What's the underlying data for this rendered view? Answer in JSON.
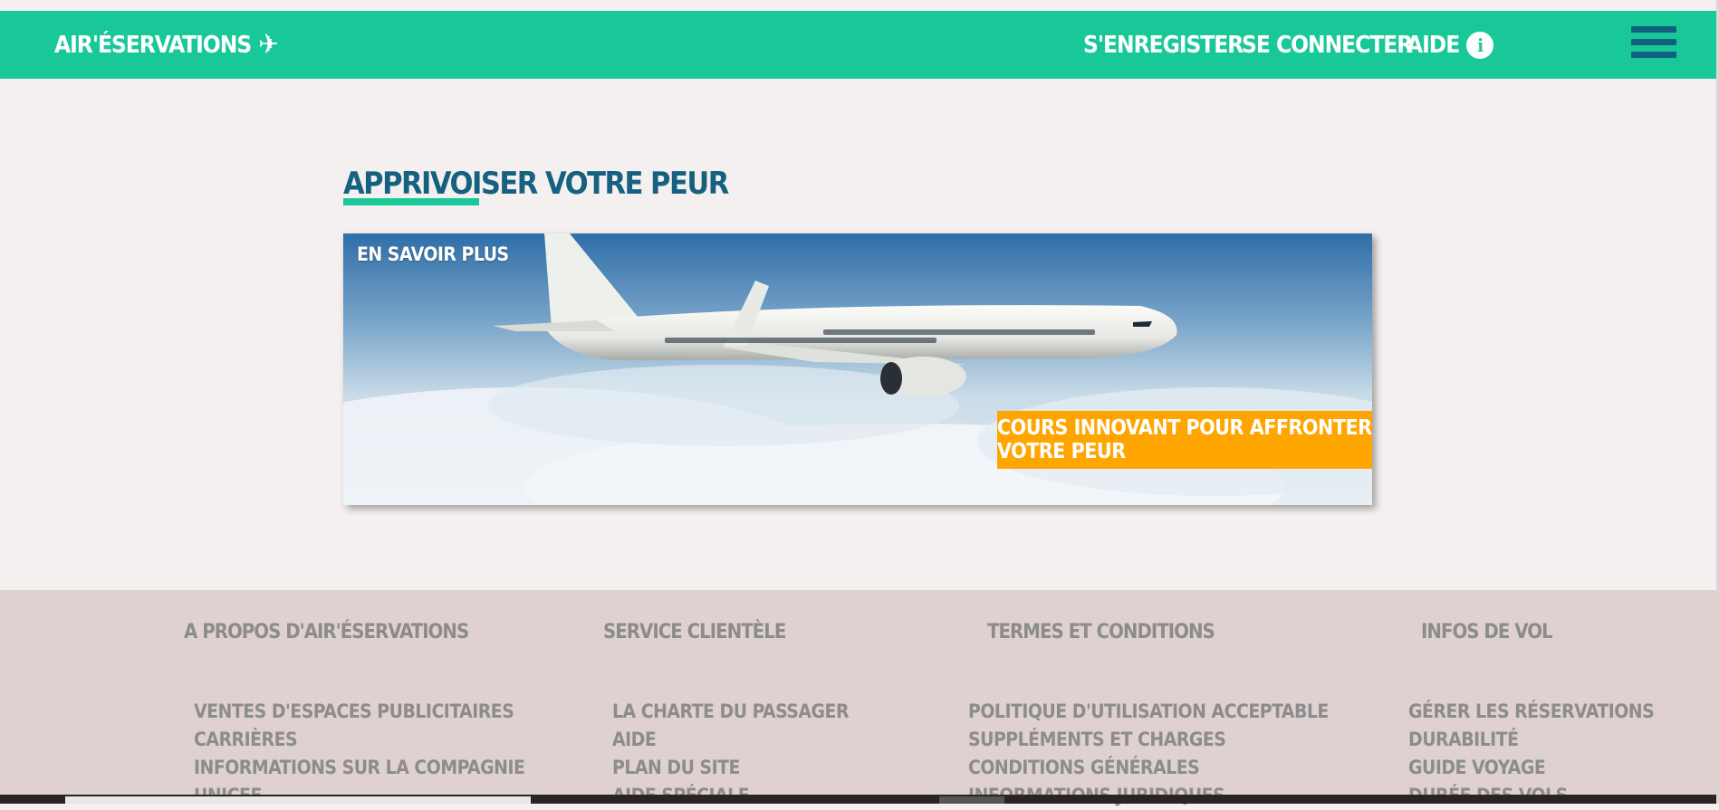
{
  "header": {
    "brand": "AIR'ÉSERVATIONS",
    "nav": {
      "register": "S'ENREGISTER",
      "login": "SE CONNECTER",
      "help": "AIDE"
    }
  },
  "main": {
    "section_title": "APPRIVOISER VOTRE PEUR",
    "hero": {
      "more_link": "EN SAVOIR PLUS",
      "cta": "COURS INNOVANT POUR AFFRONTER VOTRE PEUR"
    }
  },
  "footer": {
    "columns": [
      {
        "heading": "A PROPOS D'AIR'ÉSERVATIONS",
        "links": [
          "VENTES D'ESPACES PUBLICITAIRES",
          "CARRIÈRES",
          "INFORMATIONS SUR LA COMPAGNIE",
          "UNICEF"
        ]
      },
      {
        "heading": "SERVICE CLIENTÈLE",
        "links": [
          "LA CHARTE DU PASSAGER",
          "AIDE",
          "PLAN DU SITE",
          "AIDE SPÉCIALE"
        ]
      },
      {
        "heading": "TERMES ET CONDITIONS",
        "links": [
          "POLITIQUE D'UTILISATION ACCEPTABLE",
          "SUPPLÉMENTS ET CHARGES",
          "CONDITIONS GÉNÉRALES",
          "INFORMATIONS JURIDIQUES"
        ]
      },
      {
        "heading": "INFOS DE VOL",
        "links": [
          "GÉRER LES RÉSERVATIONS",
          "DURABILITÉ",
          "GUIDE VOYAGE",
          "DURÉE DES VOLS"
        ]
      }
    ]
  },
  "colors": {
    "header_bg": "#19c898",
    "title_color": "#16617f",
    "cta_bg": "#ffa500",
    "footer_bg": "#e0d1d1",
    "page_bg": "#f5f0f0"
  },
  "icons": {
    "brand": "airplane-icon",
    "help": "info-icon",
    "menu": "hamburger-icon"
  }
}
